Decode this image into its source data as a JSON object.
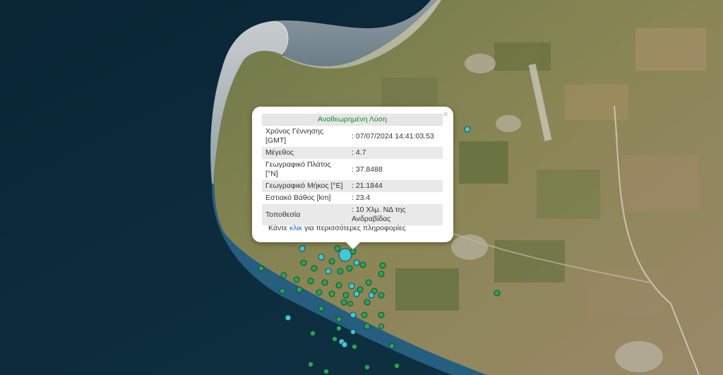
{
  "popup": {
    "title": "Αναθεωρημένη Λύση",
    "close_label": "×",
    "rows": [
      {
        "label": "Χρόνος Γέννησης [GMT]",
        "value": ": 07/07/2024 14:41:03.53"
      },
      {
        "label": "Μέγεθος",
        "value": ": 4.7"
      },
      {
        "label": "Γεωγραφικό Πλάτος [°N]",
        "value": ": 37.8488"
      },
      {
        "label": "Γεωγραφικό Μήκος [°E]",
        "value": ": 21.1844"
      },
      {
        "label": "Εστιακό Βάθος [km]",
        "value": ": 23.4"
      },
      {
        "label": "Τοποθεσία",
        "value": ": 10 Χλμ. ΝΔ της Ανδραβίδας"
      }
    ],
    "more_prefix": "Κάντε ",
    "more_link": "κλικ",
    "more_suffix": " για περισσότερες πληροφορίες"
  },
  "colors": {
    "sea_deep": "#0c2d3d",
    "sea_shallow": "#3a7aa0",
    "land": "#8a8a5a",
    "quake_green": "#2aa35a",
    "quake_cyan": "#3ec8d8",
    "title_green": "#1f8a34",
    "link_blue": "#1a5fd0"
  },
  "map": {
    "quake_markers": "green-and-cyan-circles"
  }
}
